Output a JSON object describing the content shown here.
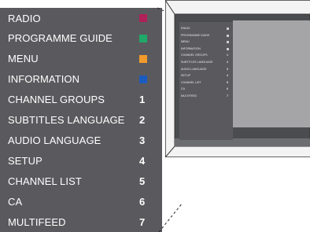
{
  "menu": {
    "items": [
      {
        "label": "RADIO",
        "marker_type": "swatch",
        "color": "#b0205a"
      },
      {
        "label": "PROGRAMME GUIDE",
        "marker_type": "swatch",
        "color": "#1fa868"
      },
      {
        "label": "MENU",
        "marker_type": "swatch",
        "color": "#f39a2c"
      },
      {
        "label": "INFORMATION",
        "marker_type": "swatch",
        "color": "#1b5bbf"
      },
      {
        "label": "CHANNEL GROUPS",
        "marker_type": "number",
        "number": "1"
      },
      {
        "label": "SUBTITLES LANGUAGE",
        "marker_type": "number",
        "number": "2"
      },
      {
        "label": "AUDIO LANGUAGE",
        "marker_type": "number",
        "number": "3"
      },
      {
        "label": "SETUP",
        "marker_type": "number",
        "number": "4"
      },
      {
        "label": "CHANNEL LIST",
        "marker_type": "number",
        "number": "5"
      },
      {
        "label": "CA",
        "marker_type": "number",
        "number": "6"
      },
      {
        "label": "MULTIFEED",
        "marker_type": "number",
        "number": "7"
      }
    ]
  },
  "tv_preview": {
    "mini_menu": {
      "items": [
        {
          "label": "RADIO",
          "mark": ""
        },
        {
          "label": "PROGRAMME GUIDE",
          "mark": ""
        },
        {
          "label": "MENU",
          "mark": ""
        },
        {
          "label": "INFORMATION",
          "mark": ""
        },
        {
          "label": "CHANNEL GROUPS",
          "mark": "1"
        },
        {
          "label": "SUBTITLES LANGUAGE",
          "mark": "2"
        },
        {
          "label": "AUDIO LANGUAGE",
          "mark": "3"
        },
        {
          "label": "SETUP",
          "mark": "4"
        },
        {
          "label": "CHANNEL LIST",
          "mark": "5"
        },
        {
          "label": "CA",
          "mark": "6"
        },
        {
          "label": "MULTIFEED",
          "mark": "7"
        }
      ]
    }
  },
  "colors": {
    "panel_bg": "#5a5a5e",
    "tv_screen_bg": "#4b4c50",
    "tv_frame": "#f3f3f3"
  }
}
